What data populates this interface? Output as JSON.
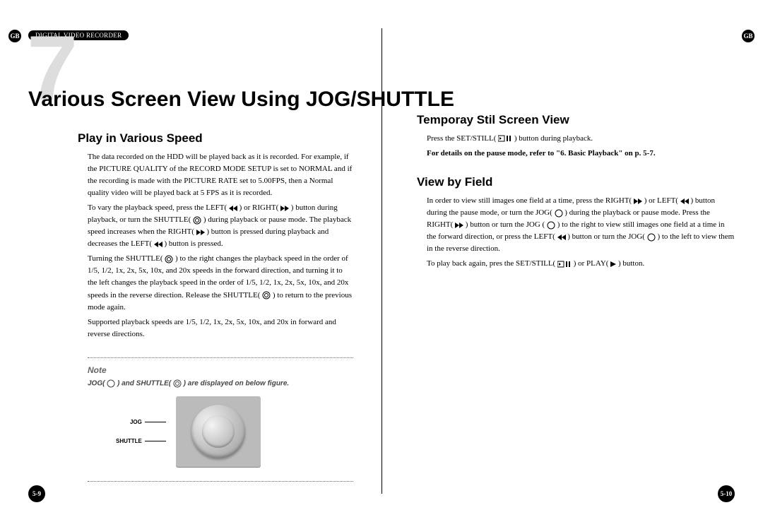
{
  "header": {
    "breadcrumb": "DIGITAL VIDEO RECORDER",
    "gb": "GB",
    "chapter_number": "7",
    "title": "Various Screen View Using JOG/SHUTTLE"
  },
  "left": {
    "section1_title": "Play in Various Speed",
    "p1": "The data recorded on the HDD will be played back as it is recorded. For example, if the PICTURE QUALITY of the RECORD MODE SETUP is set to NORMAL and if the recording is made with the PICTURE RATE set to 5.00FPS, then a Normal quality video will be played back at 5 FPS as it is recorded.",
    "p2a": "To vary the playback speed, press the LEFT( ",
    "p2b": " ) or RIGHT( ",
    "p2c": " ) button during playback, or turn the SHUTTLE( ",
    "p2d": " ) during playback or pause mode. The playback speed increases when the RIGHT( ",
    "p2e": " ) button is pressed during playback and decreases the LEFT( ",
    "p2f": " ) button is pressed.",
    "p3a": "Turning the SHUTTLE( ",
    "p3b": " ) to the right changes the playback speed in the order of 1/5, 1/2, 1x, 2x, 5x, 10x, and 20x speeds in the forward direction, and turning it to the left changes the playback speed in the order of 1/5, 1/2, 1x, 2x, 5x, 10x, and 20x speeds in the reverse direction. Release the SHUTTLE( ",
    "p3c": " ) to return to the previous mode again.",
    "p4": "Supported playback speeds are 1/5, 1/2, 1x, 2x, 5x, 10x, and 20x in forward and reverse directions.",
    "note_title": "Note",
    "note_a": "JOG( ",
    "note_b": " ) and SHUTTLE( ",
    "note_c": " ) are displayed on below figure.",
    "label_jog": "JOG",
    "label_shuttle": "SHUTTLE"
  },
  "right": {
    "section1_title": "Temporay Stil Screen View",
    "s1a": "Press the SET/STILL( ",
    "s1b": " ) button during playback.",
    "s1bold": "For details on the pause mode, refer to \"6. Basic Playback\" on p. 5-7.",
    "section2_title": "View by Field",
    "s2a": "In order to view still images one field at a time, press the RIGHT( ",
    "s2b": " ) or LEFT( ",
    "s2c": " ) button during the pause mode, or turn the JOG( ",
    "s2d": " ) during the playback or pause mode. Press the RIGHT( ",
    "s2e": " ) button or turn the JOG ( ",
    "s2f": " ) to the right to view still images one field at a time in the forward direction, or press the LEFT( ",
    "s2g": " ) button or turn the JOG( ",
    "s2h": " ) to the left to view them in the reverse direction.",
    "s3a": "To play back again, pres the SET/STILL( ",
    "s3b": " ) or PLAY( ",
    "s3c": " ) button."
  },
  "footer": {
    "page_left": "5-9",
    "page_right": "5-10"
  }
}
